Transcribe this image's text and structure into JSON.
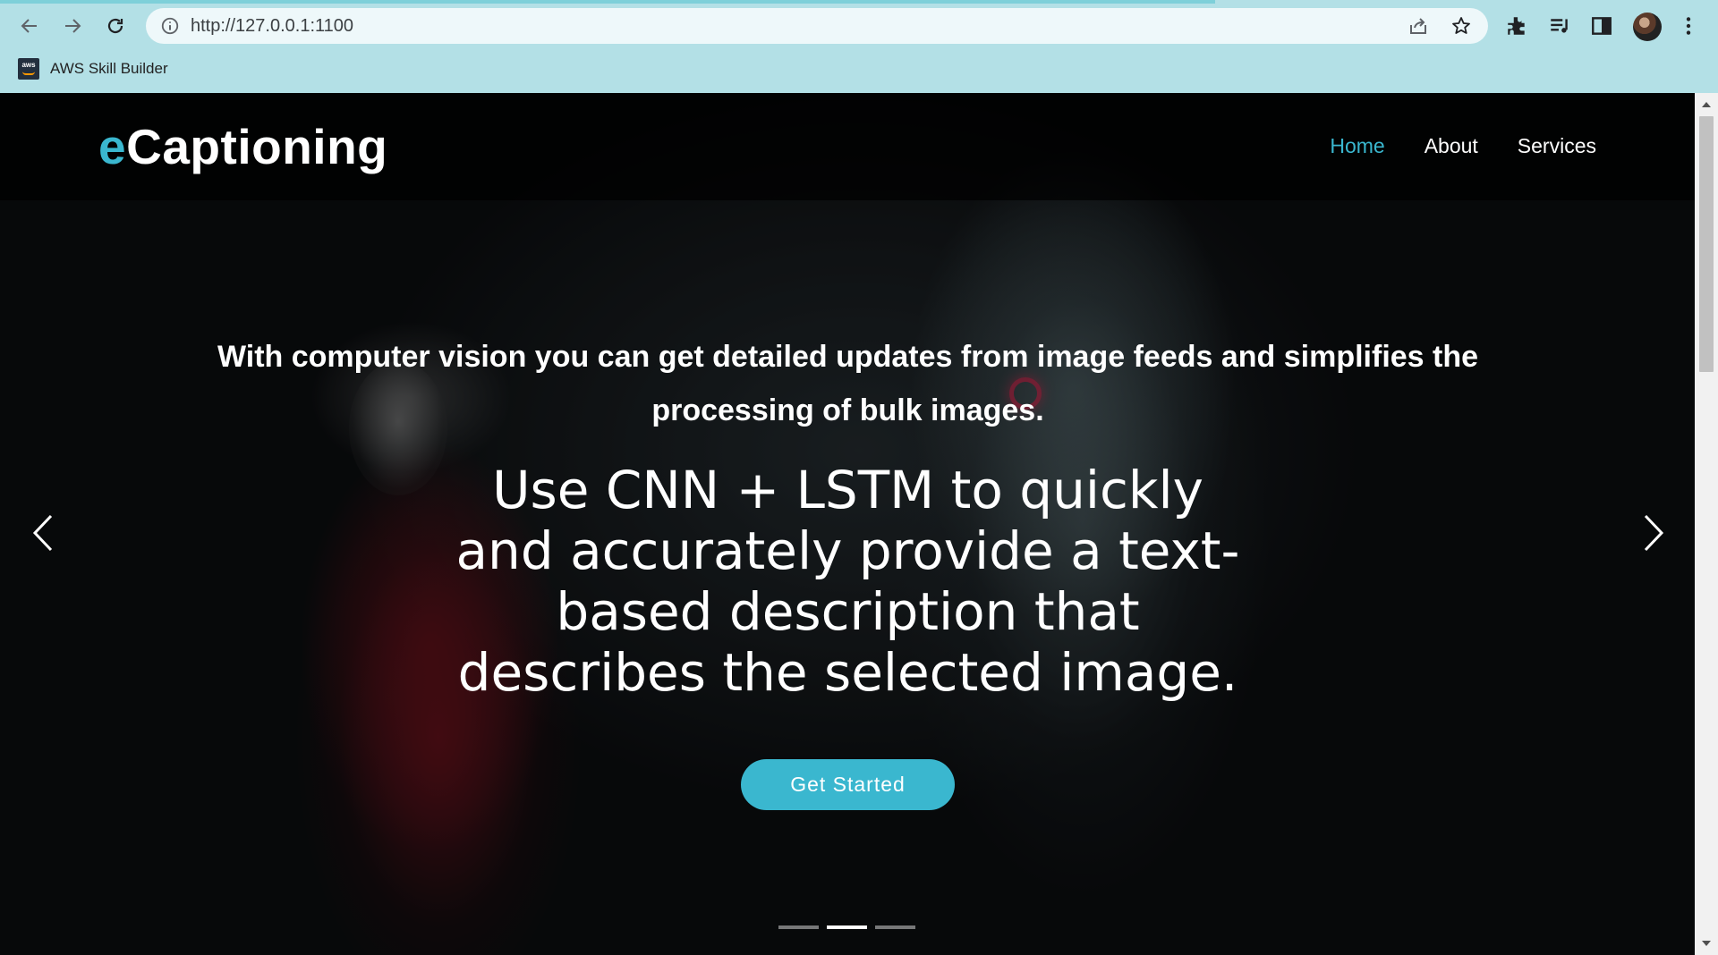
{
  "browser": {
    "url": "http://127.0.0.1:1100",
    "bookmarks": [
      {
        "label": "AWS Skill Builder",
        "favicon_text": "aws"
      }
    ],
    "icons": [
      "back-icon",
      "forward-icon",
      "reload-icon",
      "info-icon",
      "share-icon",
      "star-icon",
      "extensions-icon",
      "reading-list-icon",
      "side-panel-icon",
      "avatar",
      "menu-icon"
    ]
  },
  "site": {
    "logo_accent": "e",
    "logo_rest": "Captioning",
    "nav": [
      {
        "label": "Home",
        "active": true
      },
      {
        "label": "About",
        "active": false
      },
      {
        "label": "Services",
        "active": false
      }
    ],
    "accent_color": "#3ab7cf"
  },
  "hero": {
    "tagline": "With computer vision you can get detailed updates from image feeds and simplifies the processing of bulk images.",
    "heading": "Use CNN + LSTM to quickly and accurately provide a text-based description that describes the selected image.",
    "cta_label": "Get Started",
    "carousel": {
      "slides": 3,
      "active_index": 1
    }
  }
}
